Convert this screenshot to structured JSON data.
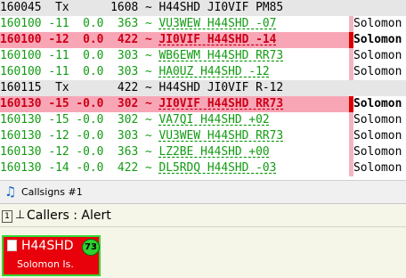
{
  "log": {
    "rows": [
      {
        "style": "tx",
        "time": "160045",
        "db": "Tx",
        "dt": "",
        "freq": "1608",
        "message": "H44SHD JI0VIF PM85",
        "entity": ""
      },
      {
        "style": "rx",
        "time": "160100",
        "db": "-11",
        "dt": "0.0",
        "freq": "363",
        "message": "VU3WEW H44SHD -07",
        "entity": "Solomon"
      },
      {
        "style": "alert",
        "time": "160100",
        "db": "-12",
        "dt": "0.0",
        "freq": "422",
        "message": "JI0VIF H44SHD -14",
        "entity": "Solomon"
      },
      {
        "style": "rx",
        "time": "160100",
        "db": "-11",
        "dt": "0.0",
        "freq": "303",
        "message": "WB6EWM H44SHD RR73",
        "entity": "Solomon"
      },
      {
        "style": "rx",
        "time": "160100",
        "db": "-11",
        "dt": "0.0",
        "freq": "303",
        "message": "HA0UZ H44SHD -12",
        "entity": "Solomon"
      },
      {
        "style": "tx",
        "time": "160115",
        "db": "Tx",
        "dt": "",
        "freq": "422",
        "message": "H44SHD JI0VIF R-12",
        "entity": ""
      },
      {
        "style": "alert",
        "time": "160130",
        "db": "-15",
        "dt": "-0.0",
        "freq": "302",
        "message": "JI0VIF H44SHD RR73",
        "entity": "Solomon"
      },
      {
        "style": "rx",
        "time": "160130",
        "db": "-15",
        "dt": "-0.0",
        "freq": "302",
        "message": "VA7QI H44SHD +02",
        "entity": "Solomon"
      },
      {
        "style": "rx",
        "time": "160130",
        "db": "-12",
        "dt": "-0.0",
        "freq": "303",
        "message": "VU3WEW H44SHD RR73",
        "entity": "Solomon"
      },
      {
        "style": "rx",
        "time": "160130",
        "db": "-12",
        "dt": "-0.0",
        "freq": "363",
        "message": "LZ2BE H44SHD +00",
        "entity": "Solomon"
      },
      {
        "style": "rx",
        "time": "160130",
        "db": "-14",
        "dt": "-0.0",
        "freq": "422",
        "message": "DL5RDQ H44SHD -03",
        "entity": "Solomon"
      }
    ]
  },
  "callsigns_bar": {
    "icon": "music-note-icon",
    "title": "Callsigns #1"
  },
  "callers": {
    "number": "1",
    "pin_glyph": "⊥",
    "title": "Callers : Alert",
    "card": {
      "callsign": "H44SHD",
      "count": "73",
      "entity": "Solomon Is."
    }
  },
  "colors": {
    "alert_bg": "#f8a6b6",
    "alert_text": "#cc0018",
    "rx_text": "#139c13",
    "card_bg": "#e8000a",
    "card_border": "#33d833"
  }
}
